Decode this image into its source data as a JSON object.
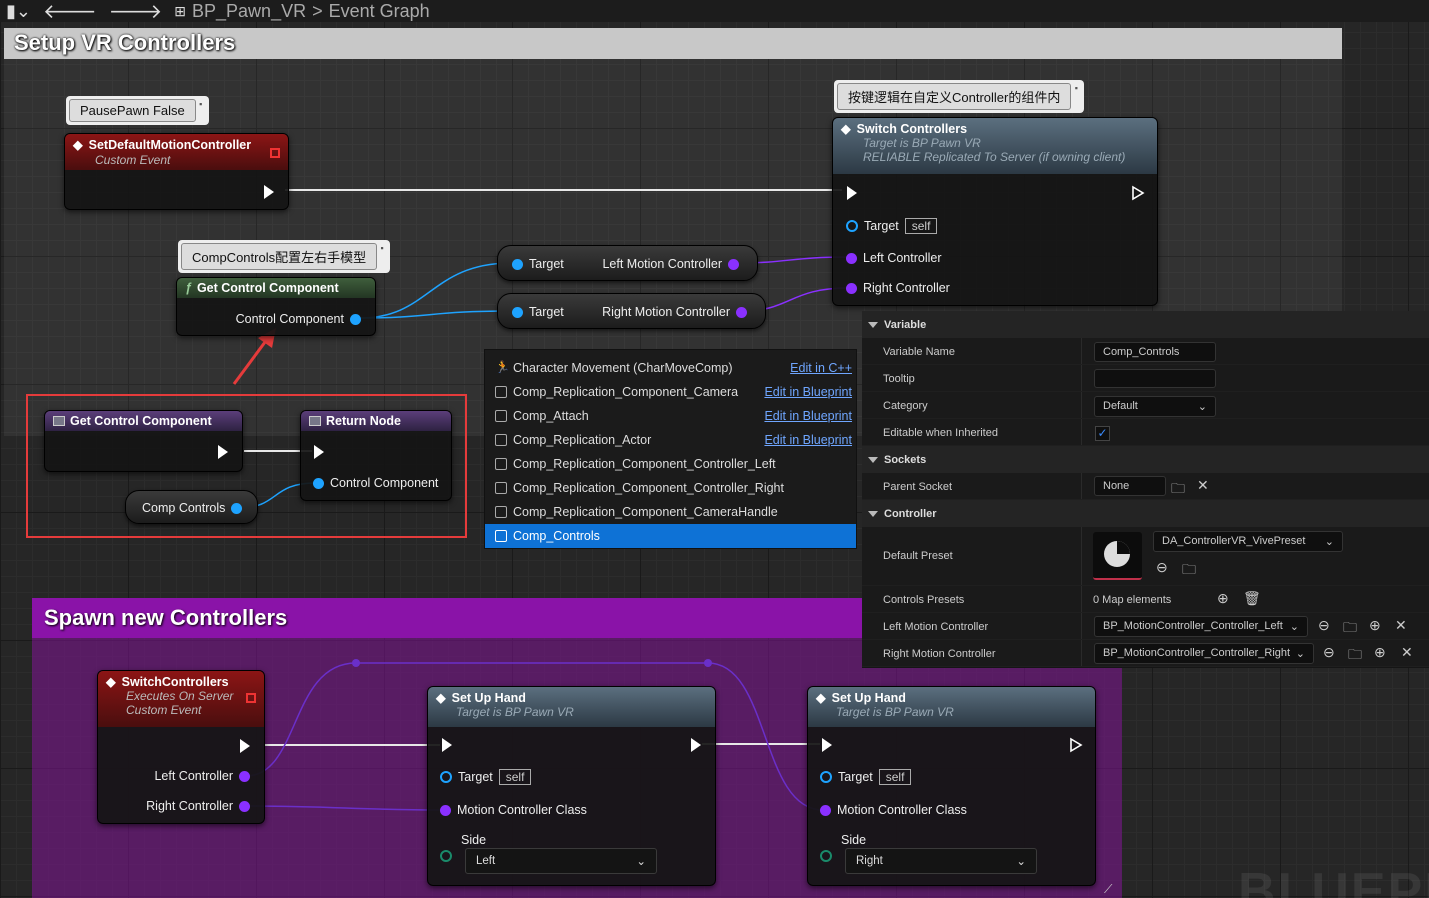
{
  "topbar": {
    "breadcrumb_asset": "BP_Pawn_VR",
    "breadcrumb_sep": ">",
    "breadcrumb_graph": "Event Graph"
  },
  "comments": {
    "setup_title": "Setup VR Controllers",
    "spawn_title": "Spawn new Controllers",
    "bubble_pause": "PausePawn False",
    "bubble_comp": "CompControls配置左右手模型",
    "bubble_switch": "按键逻辑在自定义Controller的组件内"
  },
  "nodes": {
    "set_default": {
      "title": "SetDefaultMotionController",
      "subtitle": "Custom Event"
    },
    "switch": {
      "title": "Switch Controllers",
      "sub1": "Target is BP Pawn VR",
      "sub2": "RELIABLE Replicated To Server (if owning client)",
      "target_label": "Target",
      "self_label": "self",
      "left_label": "Left Controller",
      "right_label": "Right Controller"
    },
    "get_control_func": {
      "title": "Get Control Component",
      "out_label": "Control Component"
    },
    "get_left": {
      "target": "Target",
      "out": "Left Motion Controller"
    },
    "get_right": {
      "target": "Target",
      "out": "Right Motion Controller"
    },
    "func_entry": {
      "title": "Get Control Component"
    },
    "return_node": {
      "title": "Return Node",
      "out_label": "Control Component"
    },
    "comp_controls_get": {
      "label": "Comp Controls"
    },
    "switch_event": {
      "title": "SwitchControllers",
      "sub1": "Executes On Server",
      "sub2": "Custom Event",
      "left": "Left Controller",
      "right": "Right Controller"
    },
    "setup_hand_1": {
      "title": "Set Up Hand",
      "sub": "Target is BP Pawn VR",
      "target": "Target",
      "self": "self",
      "mcc": "Motion Controller Class",
      "side_label": "Side",
      "side_value": "Left"
    },
    "setup_hand_2": {
      "title": "Set Up Hand",
      "sub": "Target is BP Pawn VR",
      "target": "Target",
      "self": "self",
      "mcc": "Motion Controller Class",
      "side_label": "Side",
      "side_value": "Right"
    }
  },
  "menu": {
    "items": [
      {
        "label": "Character Movement (CharMoveComp)",
        "link": "Edit in C++"
      },
      {
        "label": "Comp_Replication_Component_Camera",
        "link": "Edit in Blueprint"
      },
      {
        "label": "Comp_Attach",
        "link": "Edit in Blueprint"
      },
      {
        "label": "Comp_Replication_Actor",
        "link": "Edit in Blueprint"
      },
      {
        "label": "Comp_Replication_Component_Controller_Left",
        "link": ""
      },
      {
        "label": "Comp_Replication_Component_Controller_Right",
        "link": ""
      },
      {
        "label": "Comp_Replication_Component_CameraHandle",
        "link": ""
      },
      {
        "label": "Comp_Controls",
        "link": ""
      }
    ]
  },
  "details": {
    "sec_variable": "Variable",
    "variable_name_label": "Variable Name",
    "variable_name_value": "Comp_Controls",
    "tooltip_label": "Tooltip",
    "tooltip_value": "",
    "category_label": "Category",
    "category_value": "Default",
    "editable_label": "Editable when Inherited",
    "editable_checked": true,
    "sec_sockets": "Sockets",
    "parent_socket_label": "Parent Socket",
    "parent_socket_value": "None",
    "sec_controller": "Controller",
    "default_preset_label": "Default Preset",
    "default_preset_value": "DA_ControllerVR_VivePreset",
    "controls_presets_label": "Controls Presets",
    "controls_presets_value": "0 Map elements",
    "left_mc_label": "Left Motion Controller",
    "left_mc_value": "BP_MotionController_Controller_Left",
    "right_mc_label": "Right Motion Controller",
    "right_mc_value": "BP_MotionController_Controller_Right"
  },
  "watermark": "BLUEPR",
  "colors": {
    "exec": "#ffffff",
    "object_pin": "#1ea3ff",
    "class_pin": "#8a30ff",
    "selection": "#0e72d6",
    "annotation_red": "#e53b3b"
  }
}
